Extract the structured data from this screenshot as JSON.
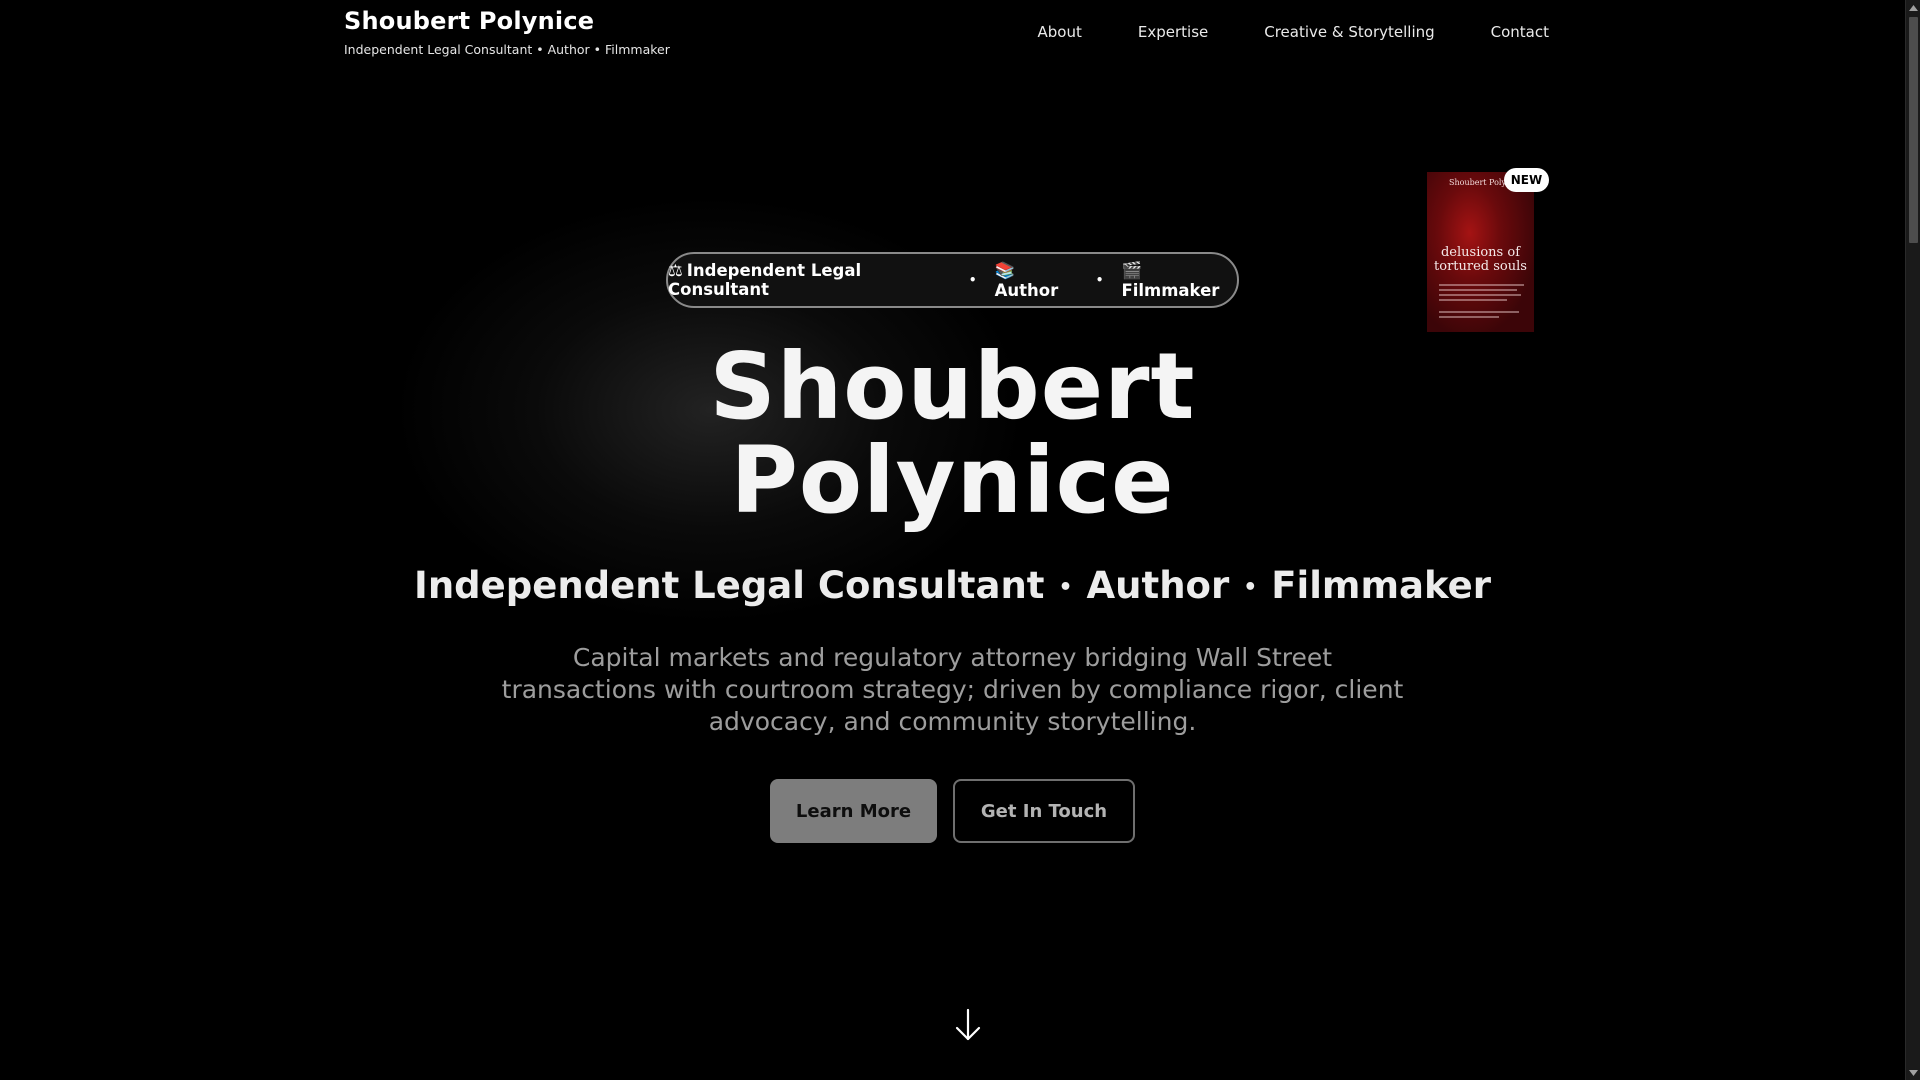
{
  "header": {
    "brand_name": "Shoubert Polynice",
    "brand_tagline": "Independent Legal Consultant • Author • Filmmaker",
    "nav": [
      {
        "label": "About"
      },
      {
        "label": "Expertise"
      },
      {
        "label": "Creative & Storytelling"
      },
      {
        "label": "Contact"
      }
    ]
  },
  "book": {
    "badge": "NEW",
    "author": "Shoubert Polynice",
    "title_line1": "delusions of",
    "title_line2": "tortured souls"
  },
  "hero": {
    "pill": {
      "items": [
        {
          "icon": "⚖",
          "label": "Independent Legal Consultant"
        },
        {
          "icon": "📚",
          "label": "Author"
        },
        {
          "icon": "🎬",
          "label": "Filmmaker"
        }
      ],
      "separator": "•"
    },
    "name_line1": "Shoubert",
    "name_line2": "Polynice",
    "roles": [
      "Independent Legal Consultant",
      "Author",
      "Filmmaker"
    ],
    "roles_separator": "•",
    "description": "Capital markets and regulatory attorney bridging Wall Street transactions with courtroom strategy; driven by compliance rigor, client advocacy, and community storytelling.",
    "primary_button": "Learn More",
    "secondary_button": "Get In Touch"
  },
  "icons": {
    "scroll_down": "arrow-down-icon"
  },
  "colors": {
    "background": "#000000",
    "text_primary": "#f4f4f4",
    "text_muted": "#9d9d9d",
    "button_primary_bg": "#7d7d7d",
    "badge_bg": "#ffffff"
  }
}
